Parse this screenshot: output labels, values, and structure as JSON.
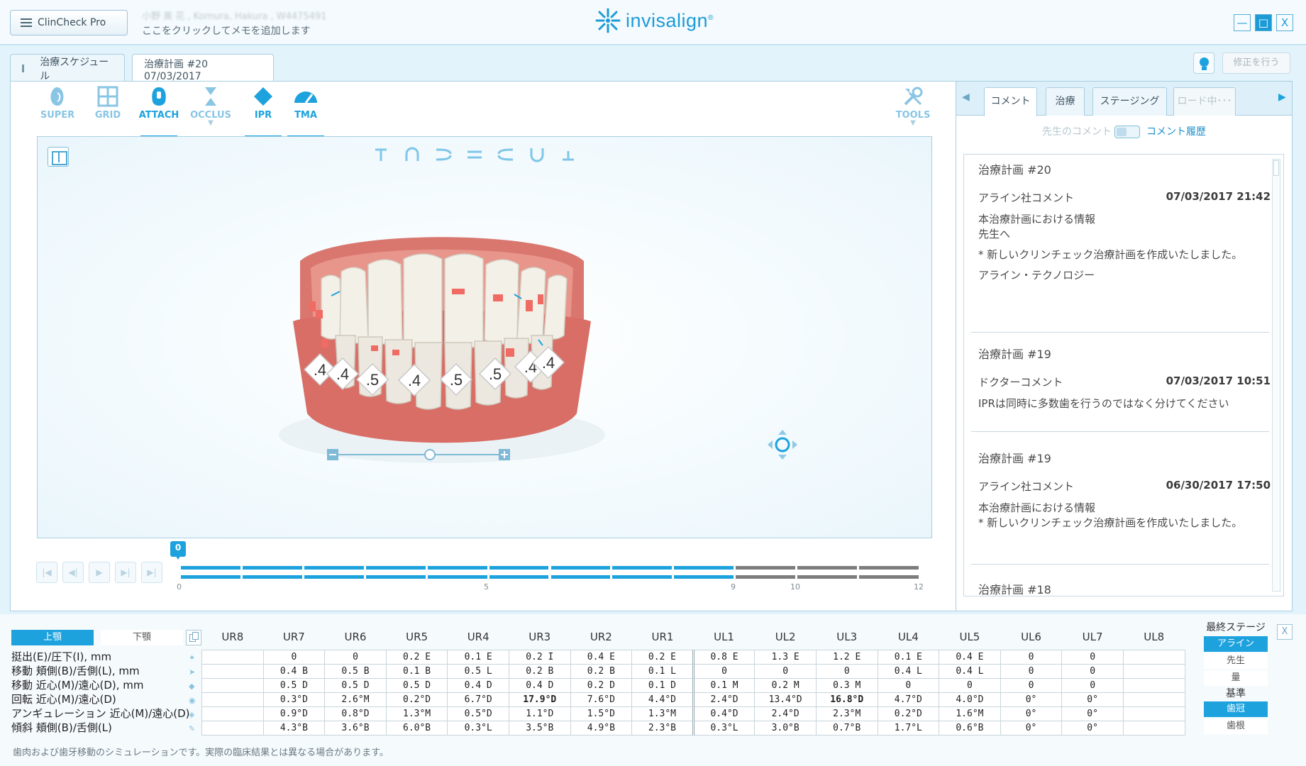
{
  "app": {
    "menu_label": "ClinCheck Pro",
    "patient_name": "小野 美 花 , Komura, Hakura , W4475491",
    "memo": "ここをクリックしてメモを追加します",
    "logo": "invisalign",
    "logo_mark": "®"
  },
  "window": {
    "minimize": "—",
    "maximize": "□",
    "close": "X"
  },
  "tabs": [
    {
      "label": "治療スケジュール"
    },
    {
      "label": "治療計画 #20 07/03/2017"
    }
  ],
  "modify_button": "修正を行う",
  "toolbar": {
    "items": [
      {
        "label": "SUPER",
        "icon": "super-icon"
      },
      {
        "label": "GRID",
        "icon": "grid-icon"
      },
      {
        "label": "ATTACH",
        "icon": "attach-icon",
        "active": true
      },
      {
        "label": "OCCLUS",
        "icon": "occlus-icon"
      },
      {
        "label": "IPR",
        "icon": "ipr-icon",
        "active": true
      },
      {
        "label": "TMA",
        "icon": "tma-icon",
        "active": true
      }
    ],
    "tools_label": "TOOLS"
  },
  "ipr_values": [
    ".4",
    ".4",
    ".5",
    ".4",
    ".5",
    ".5",
    ".4",
    ".4"
  ],
  "timeline": {
    "current_stage": "0",
    "ticks": [
      "0",
      "5",
      "9",
      "10",
      "12"
    ],
    "total_stages": 12,
    "blue_until": 9,
    "colors": {
      "active": "#1da2de",
      "future": "#7d7d7d"
    }
  },
  "right_panel": {
    "tabs": [
      "コメント",
      "治療",
      "ステージング",
      "ロード中･･･"
    ],
    "toggle_left": "先生のコメント",
    "toggle_right": "コメント履歴",
    "comments": [
      {
        "title": "治療計画 #20",
        "author": "アライン社コメント",
        "date": "07/03/2017 21:42",
        "lines": [
          "本治療計画における情報",
          "先生へ",
          "",
          "* 新しいクリンチェック治療計画を作成いたしました。",
          "",
          "アライン・テクノロジー"
        ]
      },
      {
        "title": "治療計画 #19",
        "author": "ドクターコメント",
        "date": "07/03/2017 10:51",
        "lines": [
          "IPRは同時に多数歯を行うのではなく分けてください"
        ]
      },
      {
        "title": "治療計画 #19",
        "author": "アライン社コメント",
        "date": "06/30/2017 17:50",
        "lines": [
          "本治療計画における情報",
          "* 新しいクリンチェック治療計画を作成いたしました。"
        ]
      },
      {
        "title": "治療計画 #18"
      }
    ]
  },
  "bottom": {
    "upper_jaw": "上顎",
    "lower_jaw": "下顎",
    "teeth": [
      "UR8",
      "UR7",
      "UR6",
      "UR5",
      "UR4",
      "UR3",
      "UR2",
      "UR1",
      "UL1",
      "UL2",
      "UL3",
      "UL4",
      "UL5",
      "UL6",
      "UL7",
      "UL8"
    ],
    "row_labels": [
      "挺出(E)/圧下(I), mm",
      "移動 頬側(B)/舌側(L), mm",
      "移動 近心(M)/遠心(D), mm",
      "回転 近心(M)/遠心(D)",
      "アンギュレーション 近心(M)/遠心(D)",
      "傾斜 頬側(B)/舌側(L)"
    ],
    "rows": [
      [
        "",
        "0",
        "0",
        "0.2 E",
        "0.1 E",
        "0.2 I",
        "0.4 E",
        "0.2 E",
        "0.8 E",
        "1.3 E",
        "1.2 E",
        "0.1 E",
        "0.4 E",
        "0",
        "0",
        ""
      ],
      [
        "",
        "0.4 B",
        "0.5 B",
        "0.1 B",
        "0.5 L",
        "0.2 B",
        "0.2 B",
        "0.1 L",
        "0",
        "0",
        "0",
        "0.4 L",
        "0.4 L",
        "0",
        "0",
        ""
      ],
      [
        "",
        "0.5 D",
        "0.5 D",
        "0.5 D",
        "0.4 D",
        "0.4 D",
        "0.2 D",
        "0.1 D",
        "0.1 M",
        "0.2 M",
        "0.3 M",
        "0",
        "0",
        "0",
        "0",
        ""
      ],
      [
        "",
        "0.3°D",
        "2.6°M",
        "0.2°D",
        "6.7°D",
        "17.9°D",
        "7.6°D",
        "4.4°D",
        "2.4°D",
        "13.4°D",
        "16.8°D",
        "4.7°D",
        "4.0°D",
        "0°",
        "0°",
        ""
      ],
      [
        "",
        "0.9°D",
        "0.8°D",
        "1.3°M",
        "0.5°D",
        "1.1°D",
        "1.5°D",
        "1.3°M",
        "0.4°D",
        "2.4°D",
        "2.3°M",
        "0.2°D",
        "1.6°M",
        "0°",
        "0°",
        ""
      ],
      [
        "",
        "4.3°B",
        "3.6°B",
        "6.0°B",
        "0.3°L",
        "3.5°B",
        "4.9°B",
        "2.3°B",
        "0.3°L",
        "3.0°B",
        "0.7°B",
        "1.7°L",
        "0.6°B",
        "0°",
        "0°",
        ""
      ]
    ],
    "final_stage_title": "最終ステージ",
    "final_stage_options": [
      "アライン",
      "先生",
      "量"
    ],
    "reference_title": "基準",
    "reference_options": [
      "歯冠",
      "歯根"
    ],
    "close": "X",
    "disclaimer": "歯肉および歯牙移動のシミュレーションです。実際の臨床結果とは異なる場合があります。"
  }
}
